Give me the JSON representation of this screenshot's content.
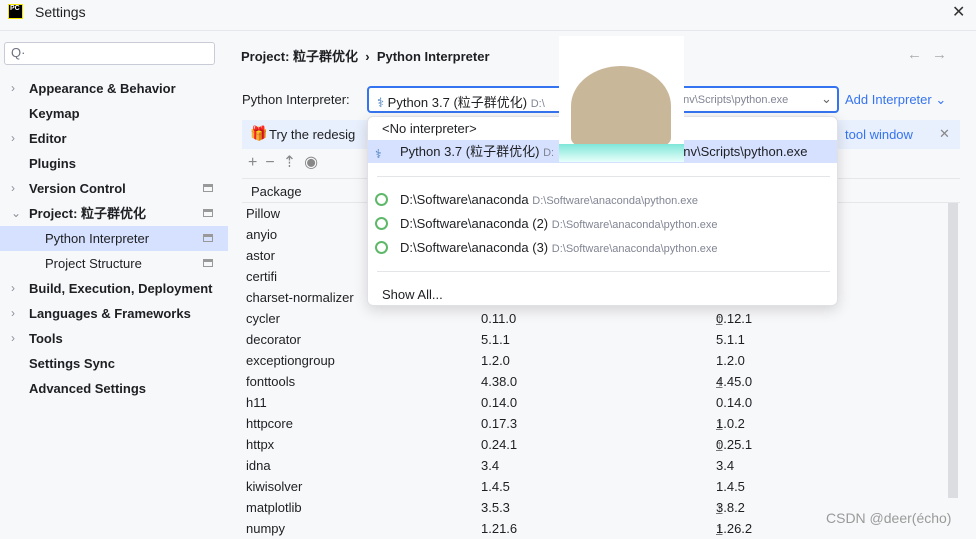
{
  "window": {
    "title": "Settings",
    "logo": "PC"
  },
  "search": {
    "placeholder": "Q·"
  },
  "sidebar": {
    "items": [
      {
        "label": "Appearance & Behavior",
        "chevron": "›"
      },
      {
        "label": "Keymap"
      },
      {
        "label": "Editor",
        "chevron": "›"
      },
      {
        "label": "Plugins"
      },
      {
        "label": "Version Control",
        "chevron": "›"
      },
      {
        "label": "Project: 粒子群优化",
        "chevron": "⌄"
      },
      {
        "label": "Python Interpreter",
        "selected": true
      },
      {
        "label": "Project Structure"
      },
      {
        "label": "Build, Execution, Deployment",
        "chevron": "›"
      },
      {
        "label": "Languages & Frameworks",
        "chevron": "›"
      },
      {
        "label": "Tools",
        "chevron": "›"
      },
      {
        "label": "Settings Sync"
      },
      {
        "label": "Advanced Settings"
      }
    ]
  },
  "breadcrumb": {
    "project": "Project: 粒子群优化",
    "sep": "›",
    "page": "Python Interpreter"
  },
  "interpreter": {
    "label": "Python Interpreter:",
    "value": "Python 3.7 (粒子群优化)",
    "path_start": "D:\\",
    "path_end": "env\\Scripts\\python.exe",
    "add": "Add Interpreter"
  },
  "banner": {
    "text": "Try the redesig",
    "link": "tool window"
  },
  "table": {
    "header": "Package",
    "rows": [
      [
        "Pillow",
        "",
        ""
      ],
      [
        "anyio",
        "",
        ""
      ],
      [
        "astor",
        "",
        ""
      ],
      [
        "certifi",
        "",
        ""
      ],
      [
        "charset-normalizer",
        "",
        ""
      ],
      [
        "cycler",
        "0.11.0",
        "0.12.1",
        true
      ],
      [
        "decorator",
        "5.1.1",
        "5.1.1",
        false
      ],
      [
        "exceptiongroup",
        "1.2.0",
        "1.2.0",
        false
      ],
      [
        "fonttools",
        "4.38.0",
        "4.45.0",
        true
      ],
      [
        "h11",
        "0.14.0",
        "0.14.0",
        false
      ],
      [
        "httpcore",
        "0.17.3",
        "1.0.2",
        true
      ],
      [
        "httpx",
        "0.24.1",
        "0.25.1",
        true
      ],
      [
        "idna",
        "3.4",
        "3.4",
        false
      ],
      [
        "kiwisolver",
        "1.4.5",
        "1.4.5",
        false
      ],
      [
        "matplotlib",
        "3.5.3",
        "3.8.2",
        true
      ],
      [
        "numpy",
        "1.21.6",
        "1.26.2",
        true
      ]
    ]
  },
  "popup": {
    "none": "<No interpreter>",
    "current": "Python 3.7 (粒子群优化)",
    "current_path_start": "D:",
    "current_path_end": "env\\Scripts\\python.exe",
    "items": [
      {
        "name": "D:\\Software\\anaconda",
        "path": "D:\\Software\\anaconda\\python.exe"
      },
      {
        "name": "D:\\Software\\anaconda (2)",
        "path": "D:\\Software\\anaconda\\python.exe"
      },
      {
        "name": "D:\\Software\\anaconda (3)",
        "path": "D:\\Software\\anaconda\\python.exe"
      }
    ],
    "show_all": "Show All..."
  },
  "watermark": "CSDN @deer(écho)"
}
